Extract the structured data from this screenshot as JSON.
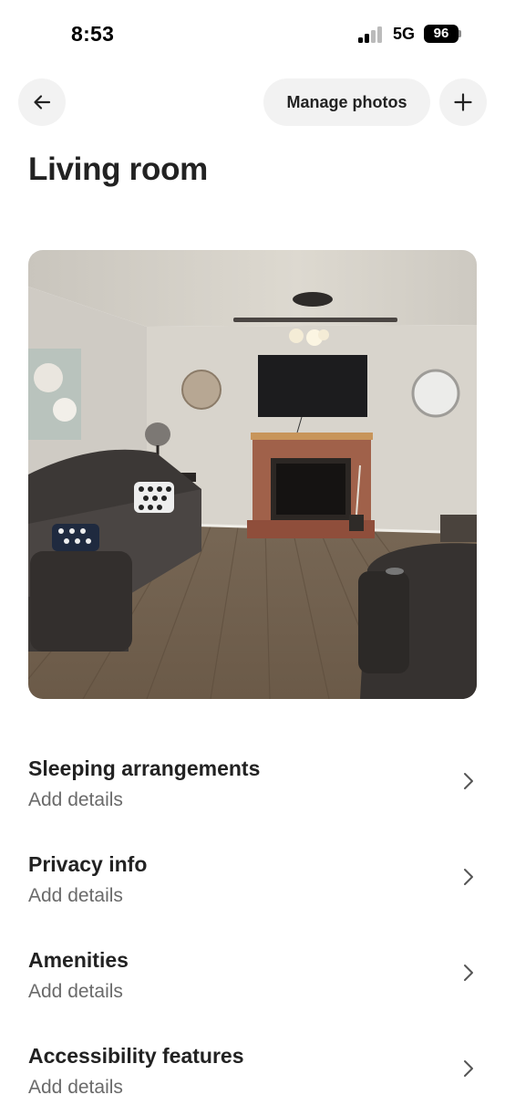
{
  "status_bar": {
    "time": "8:53",
    "network": "5G",
    "battery": "96",
    "icons": [
      "cellular-signal-icon",
      "battery-icon"
    ]
  },
  "nav": {
    "back_icon": "arrow-left-icon",
    "manage_photos_label": "Manage photos",
    "add_icon": "plus-icon"
  },
  "page": {
    "title": "Living room"
  },
  "photo": {
    "description_icon": "room-photo"
  },
  "details": [
    {
      "title": "Sleeping arrangements",
      "subtitle": "Add details"
    },
    {
      "title": "Privacy info",
      "subtitle": "Add details"
    },
    {
      "title": "Amenities",
      "subtitle": "Add details"
    },
    {
      "title": "Accessibility features",
      "subtitle": "Add details"
    }
  ],
  "colors": {
    "text_primary": "#222222",
    "text_secondary": "#6a6a6a",
    "button_bg": "#f2f2f2"
  }
}
